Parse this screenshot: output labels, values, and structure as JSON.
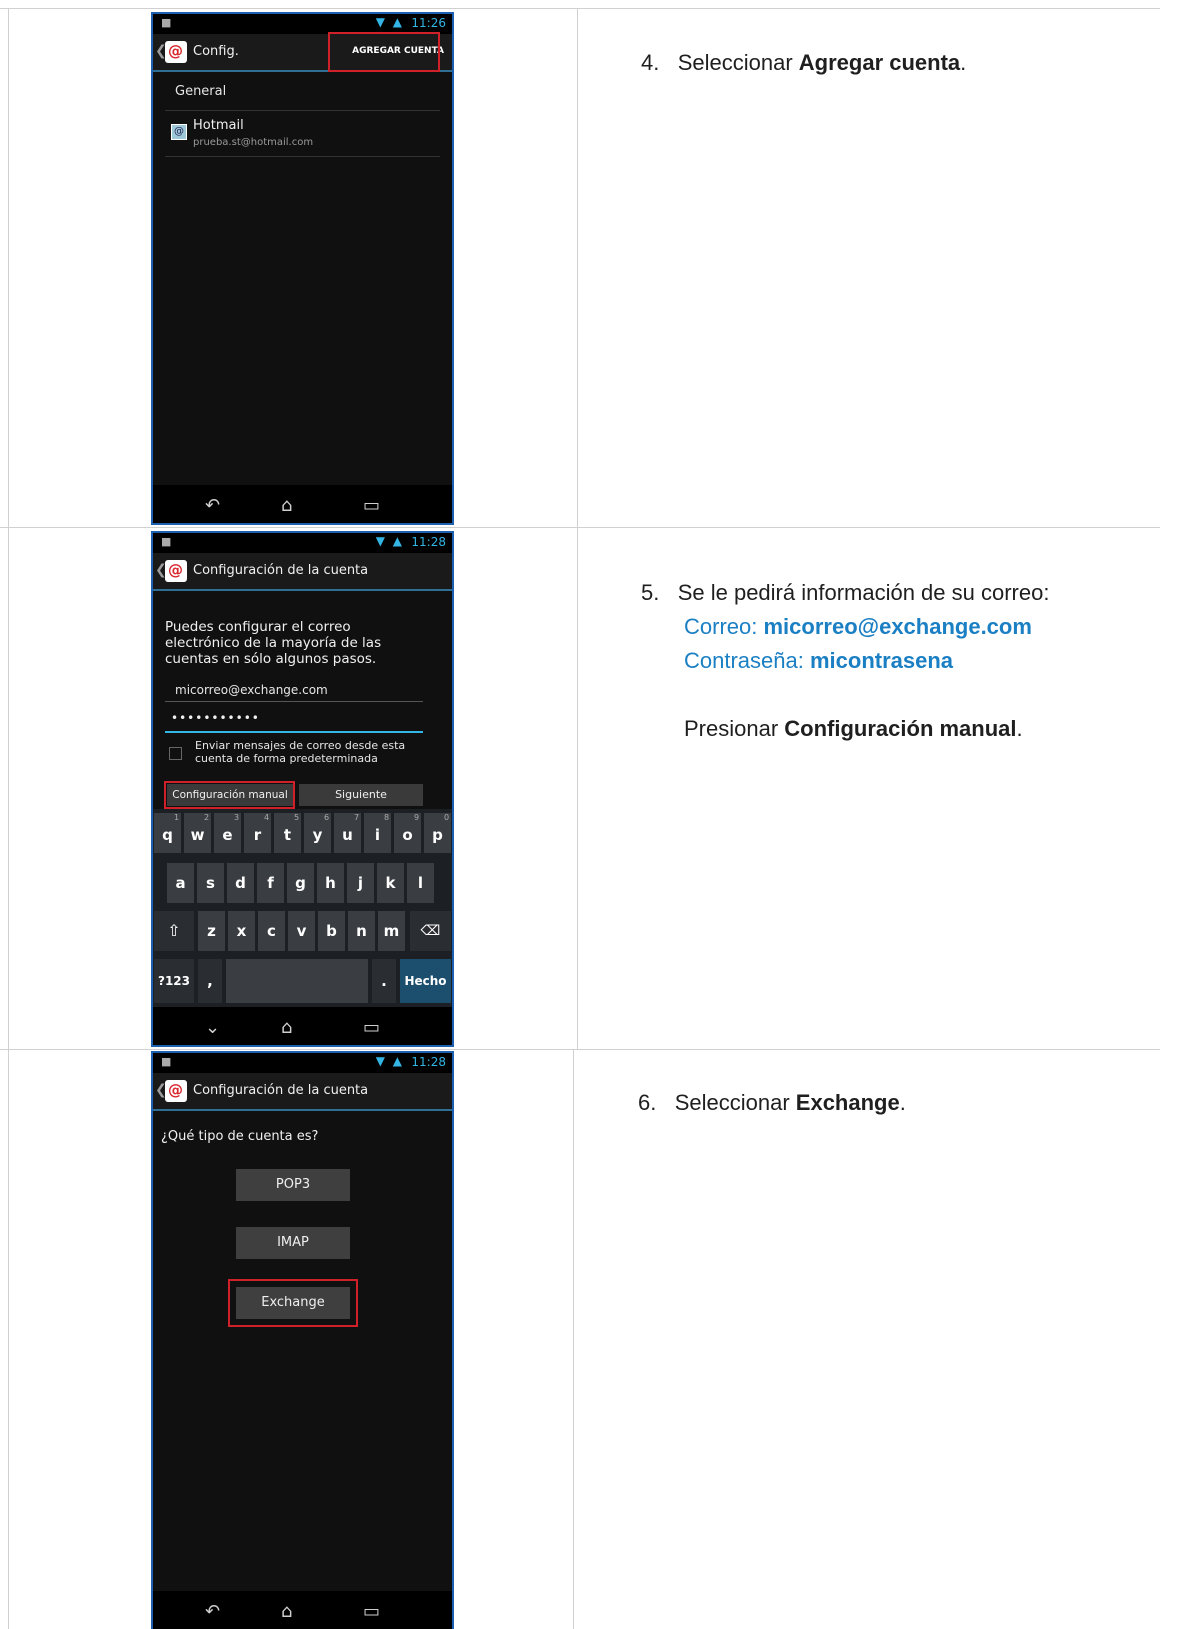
{
  "rows": [
    {
      "phone": {
        "time": "11:26",
        "title": "Config.",
        "action_label": "AGREGAR CUENTA",
        "section": "General",
        "account_name": "Hotmail",
        "account_email": "prueba.st@hotmail.com"
      },
      "step": {
        "num": "4.",
        "text_pre": "Seleccionar ",
        "text_bold": "Agregar cuenta",
        "text_post": "."
      }
    },
    {
      "phone": {
        "time": "11:28",
        "title": "Configuración de la cuenta",
        "intro": "Puedes configurar el correo electrónico de la mayoría de las cuentas en sólo algunos pasos.",
        "email_value": "micorreo@exchange.com",
        "password_value": "•••••••••••",
        "checkbox_label": "Enviar mensajes de correo desde esta cuenta de forma predeterminada",
        "manual_button": "Configuración manual",
        "next_button": "Siguiente",
        "keyboard": {
          "row1": [
            "q",
            "w",
            "e",
            "r",
            "t",
            "y",
            "u",
            "i",
            "o",
            "p"
          ],
          "row1_nums": [
            "1",
            "2",
            "3",
            "4",
            "5",
            "6",
            "7",
            "8",
            "9",
            "0"
          ],
          "row2": [
            "a",
            "s",
            "d",
            "f",
            "g",
            "h",
            "j",
            "k",
            "l"
          ],
          "row3": [
            "z",
            "x",
            "c",
            "v",
            "b",
            "n",
            "m"
          ],
          "sym_key": "?123",
          "comma_key": ",",
          "period_key": ".",
          "done_key": "Hecho"
        }
      },
      "step": {
        "num": "5.",
        "line1": "Se le pedirá información de su correo:",
        "correo_label": "Correo: ",
        "correo_value": "micorreo@exchange.com",
        "pass_label": "Contraseña: ",
        "pass_value": "micontrasena",
        "press_pre": "Presionar ",
        "press_bold": "Configuración manual",
        "press_post": "."
      }
    },
    {
      "phone": {
        "time": "11:28",
        "title": "Configuración de la cuenta",
        "question": "¿Qué tipo de cuenta es?",
        "options": [
          "POP3",
          "IMAP",
          "Exchange"
        ]
      },
      "step": {
        "num": "6.",
        "text_pre": "Seleccionar ",
        "text_bold": "Exchange",
        "text_post": "."
      }
    }
  ]
}
